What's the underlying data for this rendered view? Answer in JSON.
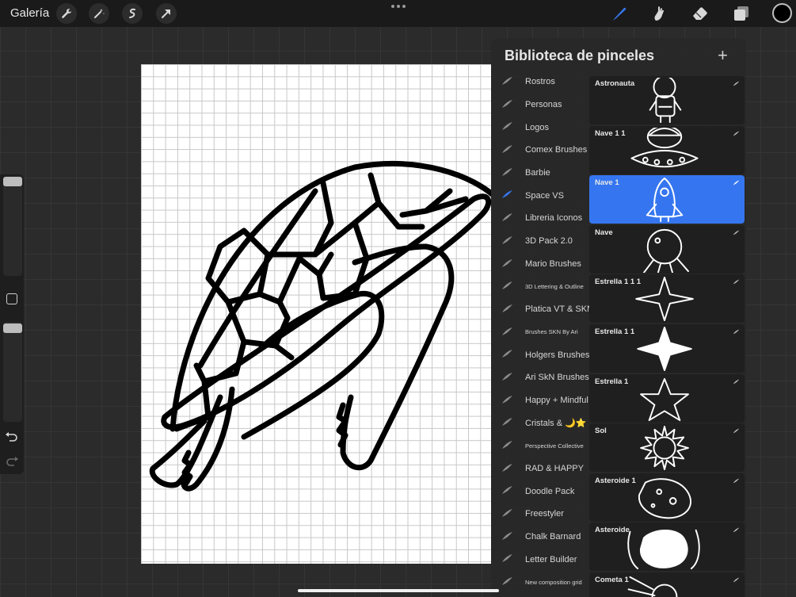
{
  "topbar": {
    "gallery_label": "Galería",
    "tools": [
      "wrench-icon",
      "magic-wand-icon",
      "selection-icon",
      "transform-arrow-icon"
    ],
    "right_tools": [
      "brush-icon",
      "smudge-icon",
      "eraser-icon",
      "layers-icon"
    ],
    "active_color": "#000000",
    "accent": "#3576f0"
  },
  "panel": {
    "title": "Biblioteca de pinceles",
    "add_label": "+",
    "sets": [
      {
        "label": "Rostros",
        "small": false,
        "active": false
      },
      {
        "label": "Personas",
        "small": false,
        "active": false
      },
      {
        "label": "Logos",
        "small": false,
        "active": false
      },
      {
        "label": "Comex Brushes",
        "small": false,
        "active": false
      },
      {
        "label": "Barbie",
        "small": false,
        "active": false
      },
      {
        "label": "Space VS",
        "small": false,
        "active": true
      },
      {
        "label": "Libreria Iconos",
        "small": false,
        "active": false
      },
      {
        "label": "3D Pack 2.0",
        "small": false,
        "active": false
      },
      {
        "label": "Mario Brushes",
        "small": false,
        "active": false
      },
      {
        "label": "3D Lettering & Outline",
        "small": true,
        "active": false
      },
      {
        "label": "Platica VT & SKN",
        "small": false,
        "active": false
      },
      {
        "label": "Brushes SKN By Ari",
        "small": true,
        "active": false
      },
      {
        "label": "Holgers Brushes",
        "small": false,
        "active": false
      },
      {
        "label": "Ari SkN Brushes",
        "small": false,
        "active": false
      },
      {
        "label": "Happy + Mindful",
        "small": false,
        "active": false
      },
      {
        "label": "Cristals & 🌙⭐",
        "small": false,
        "active": false
      },
      {
        "label": "Perspective Collective",
        "small": true,
        "active": false
      },
      {
        "label": "RAD & HAPPY",
        "small": false,
        "active": false
      },
      {
        "label": "Doodle Pack",
        "small": false,
        "active": false
      },
      {
        "label": "Freestyler",
        "small": false,
        "active": false
      },
      {
        "label": "Chalk Barnard",
        "small": false,
        "active": false
      },
      {
        "label": "Letter Builder",
        "small": false,
        "active": false
      },
      {
        "label": "New composition grid",
        "small": true,
        "active": false
      }
    ],
    "brushes": [
      {
        "name": "Astronauta",
        "stamp": "astronaut",
        "selected": false
      },
      {
        "name": "Nave 1 1",
        "stamp": "ufo",
        "selected": false
      },
      {
        "name": "Nave 1",
        "stamp": "rocket",
        "selected": true
      },
      {
        "name": "Nave",
        "stamp": "sputnik",
        "selected": false
      },
      {
        "name": "Estrella 1 1 1",
        "stamp": "star4",
        "selected": false
      },
      {
        "name": "Estrella 1 1",
        "stamp": "star4-filled",
        "selected": false
      },
      {
        "name": "Estrella 1",
        "stamp": "star5",
        "selected": false
      },
      {
        "name": "Sol",
        "stamp": "sun",
        "selected": false
      },
      {
        "name": "Asteroide 1",
        "stamp": "asteroid-rocky",
        "selected": false
      },
      {
        "name": "Asteroide",
        "stamp": "asteroid",
        "selected": false
      },
      {
        "name": "Cometa 1",
        "stamp": "comet",
        "selected": false
      }
    ]
  }
}
